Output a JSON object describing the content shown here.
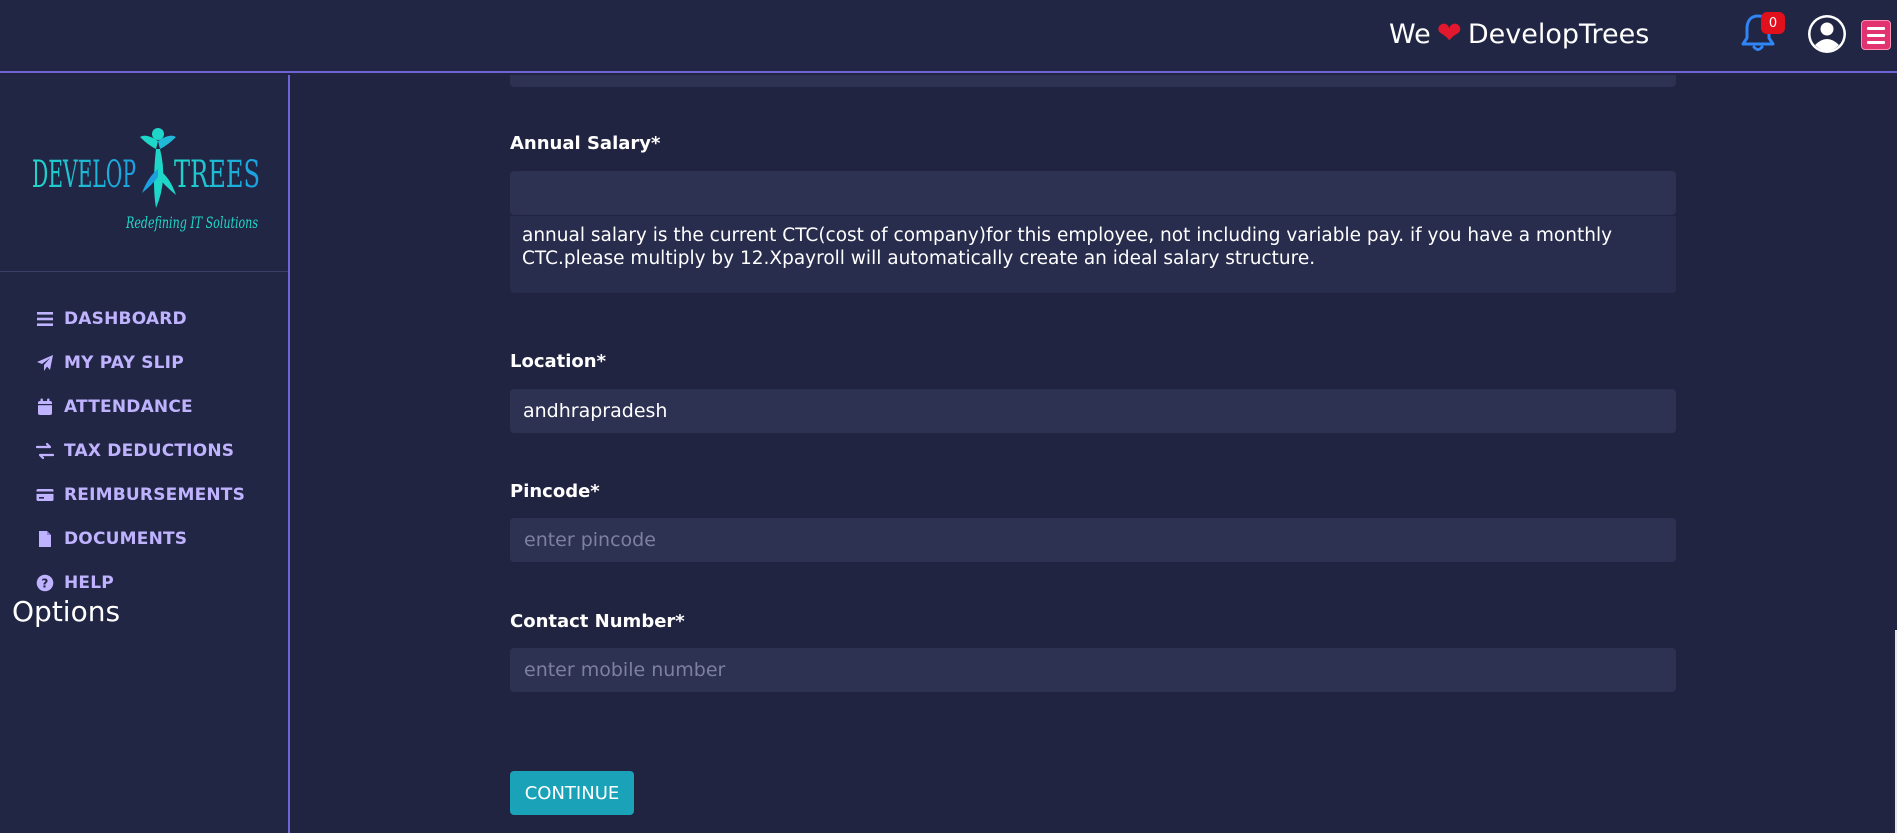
{
  "header": {
    "brand_prefix": "We",
    "brand_suffix": "DevelopTrees",
    "notification_count": "0"
  },
  "logo": {
    "text_left": "DEVELOP",
    "text_right": "TREES",
    "tagline": "Redefining IT Solutions"
  },
  "sidebar": {
    "items": [
      {
        "label": "DASHBOARD",
        "icon": "bars-icon"
      },
      {
        "label": "MY PAY SLIP",
        "icon": "paper-plane-icon"
      },
      {
        "label": "ATTENDANCE",
        "icon": "calendar-icon"
      },
      {
        "label": "TAX DEDUCTIONS",
        "icon": "exchange-icon"
      },
      {
        "label": "REIMBURSEMENTS",
        "icon": "credit-card-icon"
      },
      {
        "label": "DOCUMENTS",
        "icon": "file-icon"
      },
      {
        "label": "HELP",
        "icon": "question-circle-icon"
      }
    ],
    "options_label": "Options"
  },
  "form": {
    "annual_salary": {
      "label": "Annual Salary*",
      "value": "",
      "help_text": "annual salary is the current CTC(cost of company)for this employee, not including variable pay. if you have a monthly CTC.please multiply by 12.Xpayroll will automatically create an ideal salary structure."
    },
    "location": {
      "label": "Location*",
      "value": "andhrapradesh"
    },
    "pincode": {
      "label": "Pincode*",
      "placeholder": "enter pincode"
    },
    "contact_number": {
      "label": "Contact Number*",
      "placeholder": "enter mobile number"
    },
    "continue_label": "CONTINUE"
  },
  "colors": {
    "background": "#212441",
    "accent_border": "#6f63d6",
    "nav_text": "#bfb3ff",
    "input_bg": "#2d3152",
    "button": "#19a2b8",
    "menu_button": "#e0336f",
    "badge": "#e0101d",
    "bell": "#2f86f6"
  }
}
